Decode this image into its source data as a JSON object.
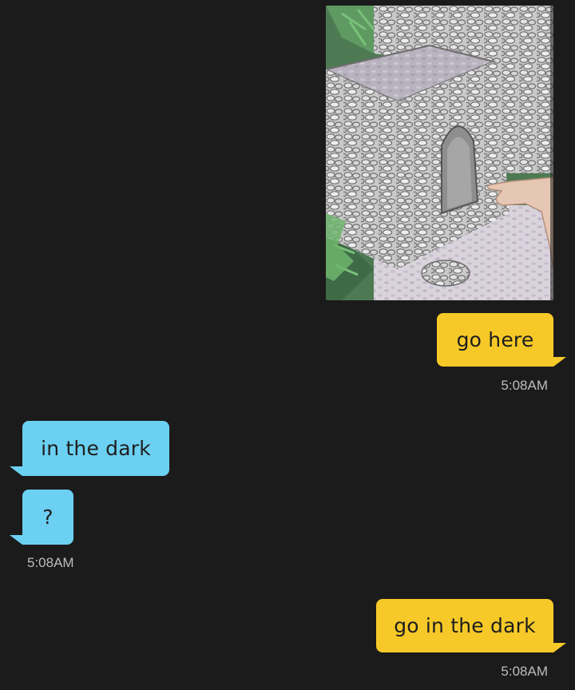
{
  "conversation": {
    "messages": [
      {
        "id": "photo",
        "direction": "outgoing",
        "type": "image",
        "image_desc_icon": "stone-hut-photo"
      },
      {
        "id": "m1",
        "direction": "outgoing",
        "text": "go here",
        "time": "5:08AM"
      },
      {
        "id": "m2",
        "direction": "incoming",
        "text": "in the dark"
      },
      {
        "id": "m3",
        "direction": "incoming",
        "text": "?",
        "time": "5:08AM"
      },
      {
        "id": "m4",
        "direction": "outgoing",
        "text": "go in the dark",
        "time": "5:08AM"
      }
    ]
  },
  "colors": {
    "background": "#1b1b1b",
    "outgoing_bubble": "#f6c928",
    "incoming_bubble": "#6cd0f2",
    "timestamp": "#bdbdbd"
  }
}
